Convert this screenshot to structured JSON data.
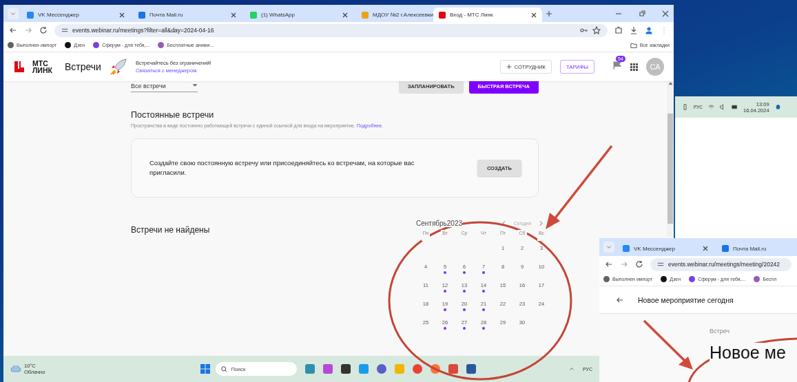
{
  "main_window": {
    "tabs": [
      {
        "title": "VK Мессенджер",
        "color": "#2787f5",
        "selected": false
      },
      {
        "title": "Почта Mail.ru",
        "color": "#1a73e8",
        "selected": false
      },
      {
        "title": "(1) WhatsApp",
        "color": "#25d366",
        "selected": false
      },
      {
        "title": "МДОУ №2 г.Алексеевки",
        "color": "#e8a317",
        "selected": false
      },
      {
        "title": "Вход - МТС Линк",
        "color": "#e30611",
        "selected": true
      }
    ],
    "address": "events.webinar.ru/meetings?filter=all&day=2024-04-16",
    "bookmarks": [
      {
        "title": "Выполнен импорт",
        "color": "#5f6368"
      },
      {
        "title": "Дзен",
        "color": "#111111"
      },
      {
        "title": "Сферум - для тебя,...",
        "color": "#7b3fe4"
      },
      {
        "title": "Бесплатные аними...",
        "color": "#9b59b6"
      }
    ],
    "all_bookmarks": "Все закладки",
    "header": {
      "logo_lines": [
        "МТС",
        "ЛИНК"
      ],
      "app": "Встречи",
      "promo": "Встречайтесь без ограничений!",
      "promo_link": "Связаться с менеджером",
      "add_employee": "СОТРУДНИК",
      "tariffs": "ТАРИФЫ",
      "badge": "54",
      "avatar": "СА"
    },
    "toolbar": {
      "filter": "Все встречи",
      "plan": "ЗАПЛАНИРОВАТЬ",
      "quick": "БЫСТРАЯ ВСТРЕЧА"
    },
    "permanent": {
      "title": "Постоянные встречи",
      "description": "Пространства в виде постоянно работающей встречи с единой ссылкой для входа на мероприятие.",
      "link": "Подробнее.",
      "card_text": "Создайте свою постоянную встречу или присоединяйтесь ко встречам, на которые вас пригласили.",
      "create": "СОЗДАТЬ"
    },
    "empty": "Встречи не найдены",
    "calendar": {
      "month": "Сентябрь2023",
      "today": "Сегодня",
      "weekdays": [
        "Пн",
        "Вт",
        "Ср",
        "Чт",
        "Пт",
        "Сб",
        "Вс"
      ],
      "weeks": [
        {
          "days": [
            {
              "day": "1",
              "event": false
            },
            {
              "day": "2",
              "event": false
            },
            {
              "day": "3",
              "event": false
            }
          ]
        },
        {
          "days": [
            {
              "day": "4",
              "event": false
            },
            {
              "day": "5",
              "event": true
            },
            {
              "day": "6",
              "event": true
            },
            {
              "day": "7",
              "event": true
            },
            {
              "day": "8",
              "event": false
            },
            {
              "day": "9",
              "event": false
            },
            {
              "day": "10",
              "event": false
            }
          ]
        },
        {
          "days": [
            {
              "day": "11",
              "event": false
            },
            {
              "day": "12",
              "event": true
            },
            {
              "day": "13",
              "event": true
            },
            {
              "day": "14",
              "event": true
            },
            {
              "day": "15",
              "event": false
            },
            {
              "day": "16",
              "event": false
            },
            {
              "day": "17",
              "event": false
            }
          ]
        },
        {
          "days": [
            {
              "day": "18",
              "event": false
            },
            {
              "day": "19",
              "event": true
            },
            {
              "day": "20",
              "event": true
            },
            {
              "day": "21",
              "event": true
            },
            {
              "day": "22",
              "event": false
            },
            {
              "day": "23",
              "event": false
            },
            {
              "day": "24",
              "event": false
            }
          ]
        },
        {
          "days": [
            {
              "day": "25",
              "event": false
            },
            {
              "day": "26",
              "event": true
            },
            {
              "day": "27",
              "event": true
            },
            {
              "day": "28",
              "event": true
            },
            {
              "day": "29",
              "event": false
            },
            {
              "day": "30",
              "event": false
            }
          ]
        }
      ]
    }
  },
  "taskbar": {
    "temperature": "10°C",
    "weather": "Облачно",
    "search": "Поиск",
    "language": "РУС"
  },
  "second_tray": {
    "language": "РУС",
    "time": "13:09",
    "date": "16.04.2024"
  },
  "third_window": {
    "tabs": [
      {
        "title": "VK Мессенджер",
        "color": "#2787f5"
      },
      {
        "title": "Почта Mail.ru",
        "color": "#1a73e8"
      }
    ],
    "address": "events.webinar.ru/meetings/meeting/20242",
    "bookmarks": [
      {
        "title": "Выполнен импорт",
        "color": "#5f6368"
      },
      {
        "title": "Дзен",
        "color": "#111111"
      },
      {
        "title": "Сферум - для тебя,...",
        "color": "#7b3fe4"
      },
      {
        "title": "Беспл",
        "color": "#9b59b6"
      }
    ],
    "title": "Новое мероприятие сегодня",
    "label": "Встреч",
    "big_title": "Новое ме"
  }
}
